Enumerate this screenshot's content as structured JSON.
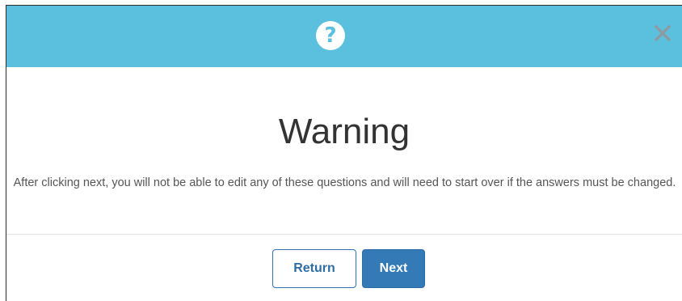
{
  "header": {
    "icon": "question-circle-icon",
    "icon_glyph": "?",
    "close_icon": "close-icon",
    "color": "#5bc0de"
  },
  "dialog": {
    "title": "Warning",
    "message": "After clicking next, you will not be able to edit any of these questions and will need to start over if the answers must be changed."
  },
  "buttons": {
    "return_label": "Return",
    "next_label": "Next",
    "primary_color": "#337ab7"
  }
}
